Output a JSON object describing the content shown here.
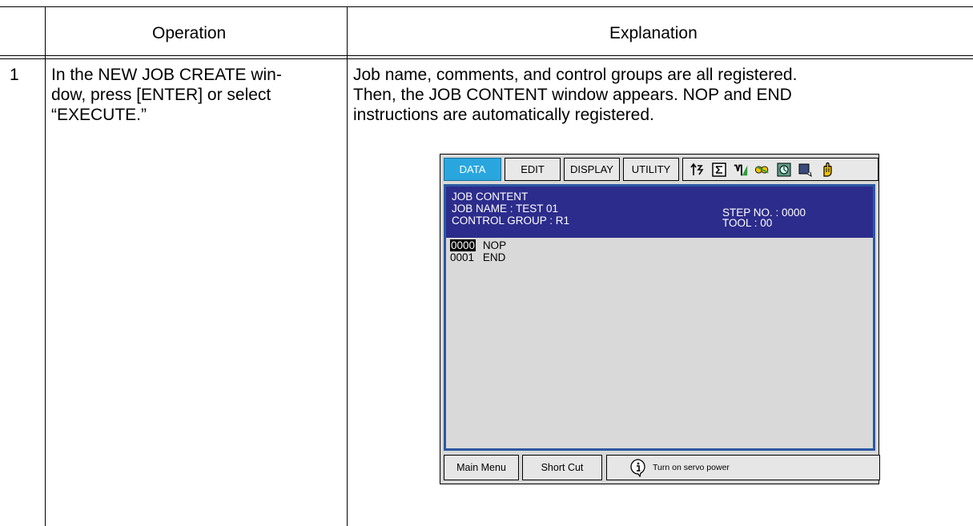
{
  "table": {
    "headers": {
      "operation": "Operation",
      "explanation": "Explanation"
    },
    "rows": [
      {
        "step": "1",
        "operation_lines": [
          "In the NEW JOB CREATE win-",
          "dow, press [ENTER] or select",
          "“EXECUTE.”"
        ],
        "explanation_lines": [
          "Job name, comments, and control groups are all registered.",
          "Then, the JOB CONTENT window appears.  NOP and END",
          "instructions are automatically registered."
        ]
      }
    ]
  },
  "pendant": {
    "menu": [
      "DATA",
      "EDIT",
      "DISPLAY",
      "UTILITY"
    ],
    "active_menu": "DATA",
    "status_icons": [
      "cycle-icon",
      "step-icon",
      "robot-icon",
      "key-icon",
      "servo-icon",
      "play-mode-icon",
      "hand-icon"
    ],
    "header": {
      "title": "JOB CONTENT",
      "job_name": "JOB NAME : TEST 01",
      "control_group": "CONTROL GROUP : R1",
      "step_no": "STEP NO. : 0000",
      "tool": "TOOL : 00"
    },
    "job_lines": [
      {
        "no": "0000",
        "instruction": "NOP"
      },
      {
        "no": "0001",
        "instruction": "END"
      }
    ],
    "footer": {
      "main_menu": "Main Menu",
      "short_cut": "Short Cut",
      "message": "Turn on servo power"
    },
    "colors": {
      "active_tab": "#2aa6df",
      "header_bg": "#2c2c8c",
      "frame": "#2b58a3"
    }
  }
}
